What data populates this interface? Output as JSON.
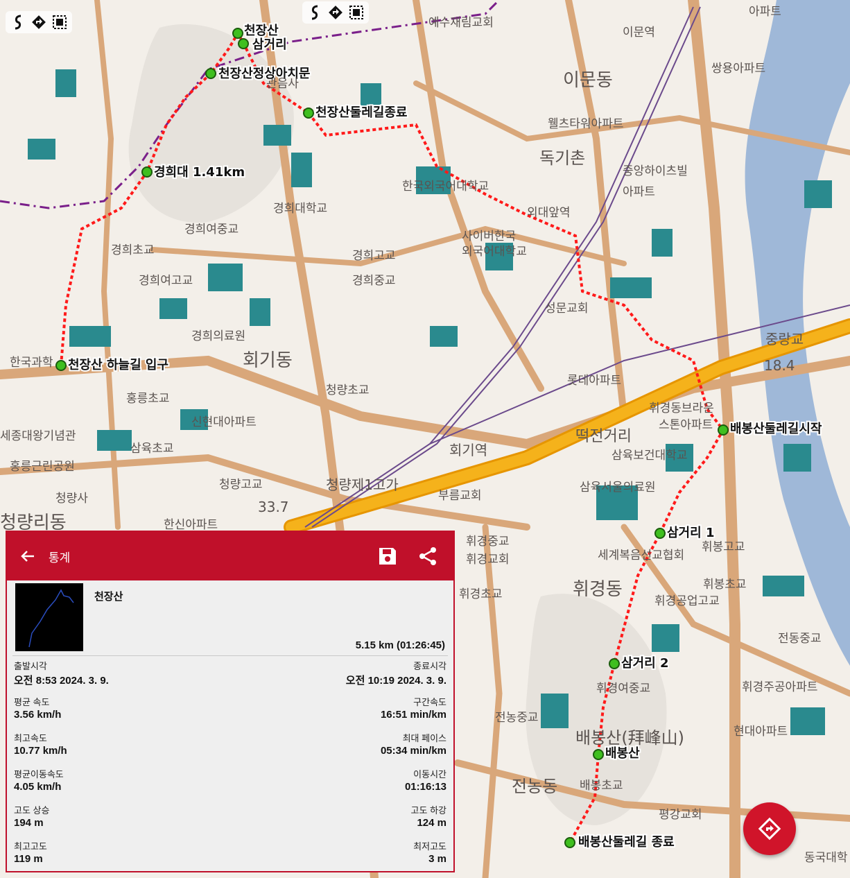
{
  "map": {
    "waypoints": [
      {
        "name": "천장산"
      },
      {
        "name": "삼거리"
      },
      {
        "name": "천장산정상아치문"
      },
      {
        "name": "천장산둘레길종료"
      },
      {
        "name": "경희대 1.41km"
      },
      {
        "name": "천장산 하늘길 입구"
      },
      {
        "name": "배봉산둘레길시작"
      },
      {
        "name": "삼거리 1"
      },
      {
        "name": "삼거리 2"
      },
      {
        "name": "배봉산"
      },
      {
        "name": "배봉산둘레길 종료"
      }
    ],
    "labels": [
      "예수재림교회",
      "이문역",
      "아파트",
      "이문동",
      "쌍용아파트",
      "관음사",
      "웰츠타워아파트",
      "독기촌",
      "중앙하이츠빌",
      "아파트",
      "한국외국어대학교",
      "외대앞역",
      "경희대학교",
      "경희여중교",
      "경희초교",
      "사이버한국",
      "외국어대학교",
      "경희고교",
      "경희중교",
      "경희여고교",
      "성문교회",
      "경희의료원",
      "회기동",
      "한국과학",
      "중랑교",
      "18.4",
      "롯데아파트",
      "청량초교",
      "휘경동브라운",
      "스톤아파트",
      "홍릉초교",
      "신현대아파트",
      "세종대왕기념관",
      "회기역",
      "떡전거리",
      "삼육보건대학교",
      "삼육초교",
      "홍릉근린공원",
      "삼육서울의료원",
      "청량고교",
      "33.7",
      "청량제1고가",
      "부름교회",
      "청량사",
      "청량리동",
      "한신아파트",
      "휘경중교",
      "휘경교회",
      "세계복음선교협회",
      "휘봉고교",
      "휘경동",
      "휘봉초교",
      "휘경공업고교",
      "휘경초교",
      "전동중교",
      "휘경주공아파트",
      "휘경여중교",
      "전농중교",
      "현대아파트",
      "배봉산(拜峰山)",
      "배봉초교",
      "전농동",
      "평강교회",
      "동국대학"
    ]
  },
  "stats": {
    "header_title": "통계",
    "track_name": "천장산",
    "track_total": "5.15 km (01:26:45)",
    "rows": [
      {
        "left_label": "출발시각",
        "left_value": "오전 8:53 2024. 3. 9.",
        "right_label": "종료시각",
        "right_value": "오전 10:19 2024. 3. 9."
      },
      {
        "left_label": "평균 속도",
        "left_value": "3.56 km/h",
        "right_label": "구간속도",
        "right_value": "16:51 min/km"
      },
      {
        "left_label": "최고속도",
        "left_value": "10.77 km/h",
        "right_label": "최대 페이스",
        "right_value": "05:34 min/km"
      },
      {
        "left_label": "평균이동속도",
        "left_value": "4.05 km/h",
        "right_label": "이동시간",
        "right_value": "01:16:13"
      },
      {
        "left_label": "고도 상승",
        "left_value": "194 m",
        "right_label": "고도 하강",
        "right_value": "124 m"
      },
      {
        "left_label": "최고고도",
        "left_value": "119 m",
        "right_label": "최저고도",
        "right_value": "3 m"
      }
    ]
  },
  "colors": {
    "accent": "#c0102a",
    "route": "#ff1a1a",
    "road": "#d9a77a",
    "highway": "#f0a500",
    "building": "#2a8a8e",
    "water": "#9fb8d8"
  }
}
